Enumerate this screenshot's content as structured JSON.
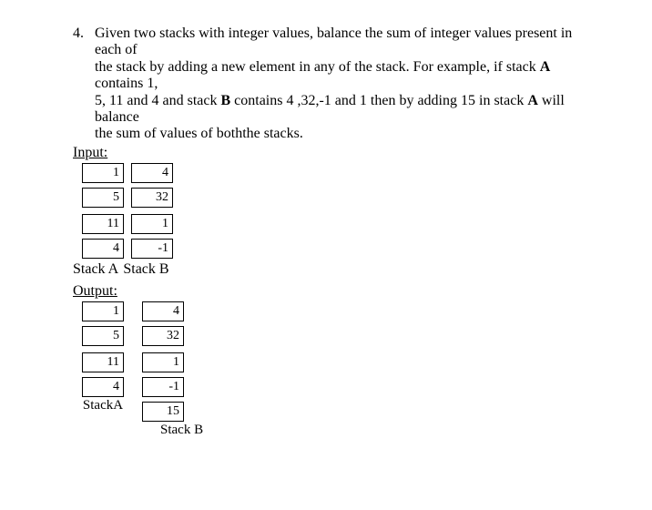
{
  "problem": {
    "number": "4.",
    "line1_a": "Given two stacks with integer values, balance the sum of integer values present in each of",
    "line2_a": "the stack by adding a new element in any of the stack. For example, if stack ",
    "line2_b": "A",
    "line2_c": " contains 1,",
    "line3_a": "5, 11 and 4 and stack ",
    "line3_b": "B",
    "line3_c": " contains 4 ,32,-1 and 1 then by adding 15 in stack ",
    "line3_d": "A",
    "line3_e": " will balance",
    "line4": "the sum of values of boththe stacks."
  },
  "input": {
    "label": "Input:",
    "stackA": [
      "1",
      "5",
      "11",
      "4"
    ],
    "stackB": [
      "4",
      "32",
      "1",
      "-1"
    ],
    "labelA": "Stack A",
    "labelB": "Stack B"
  },
  "output": {
    "label": "Output:",
    "stackA": [
      "1",
      "5",
      "11",
      "4"
    ],
    "stackB": [
      "4",
      "32",
      "1",
      "-1",
      "15"
    ],
    "labelA": "StackA",
    "labelB": "Stack B"
  }
}
